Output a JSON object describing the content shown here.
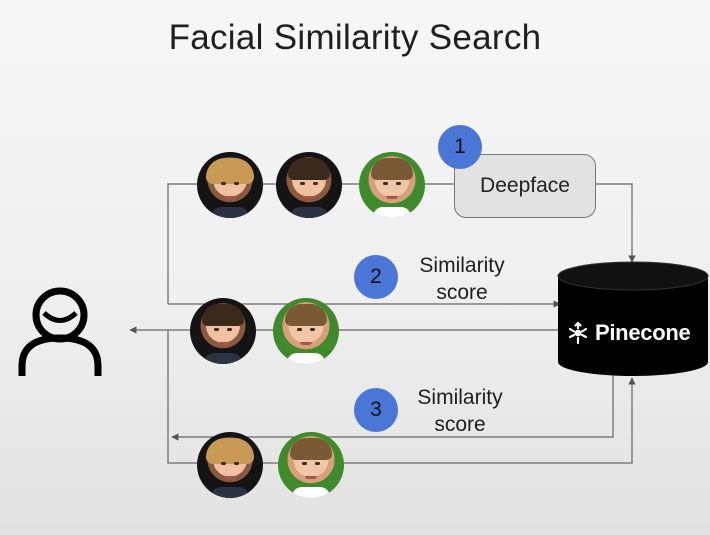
{
  "title": "Facial Similarity Search",
  "deepface_label": "Deepface",
  "steps": [
    {
      "number": "1"
    },
    {
      "number": "2",
      "label_line1": "Similarity",
      "label_line2": "score"
    },
    {
      "number": "3",
      "label_line1": "Similarity",
      "label_line2": "score"
    }
  ],
  "database": {
    "name": "Pinecone",
    "icon": "pinecone-logo-icon"
  },
  "icons": {
    "user": "user-icon",
    "faces": "face-photo-icon"
  },
  "colors": {
    "badge": "#4a76d8",
    "database": "#000000",
    "line": "#555555",
    "deepface_box": "#e2e2e2"
  }
}
